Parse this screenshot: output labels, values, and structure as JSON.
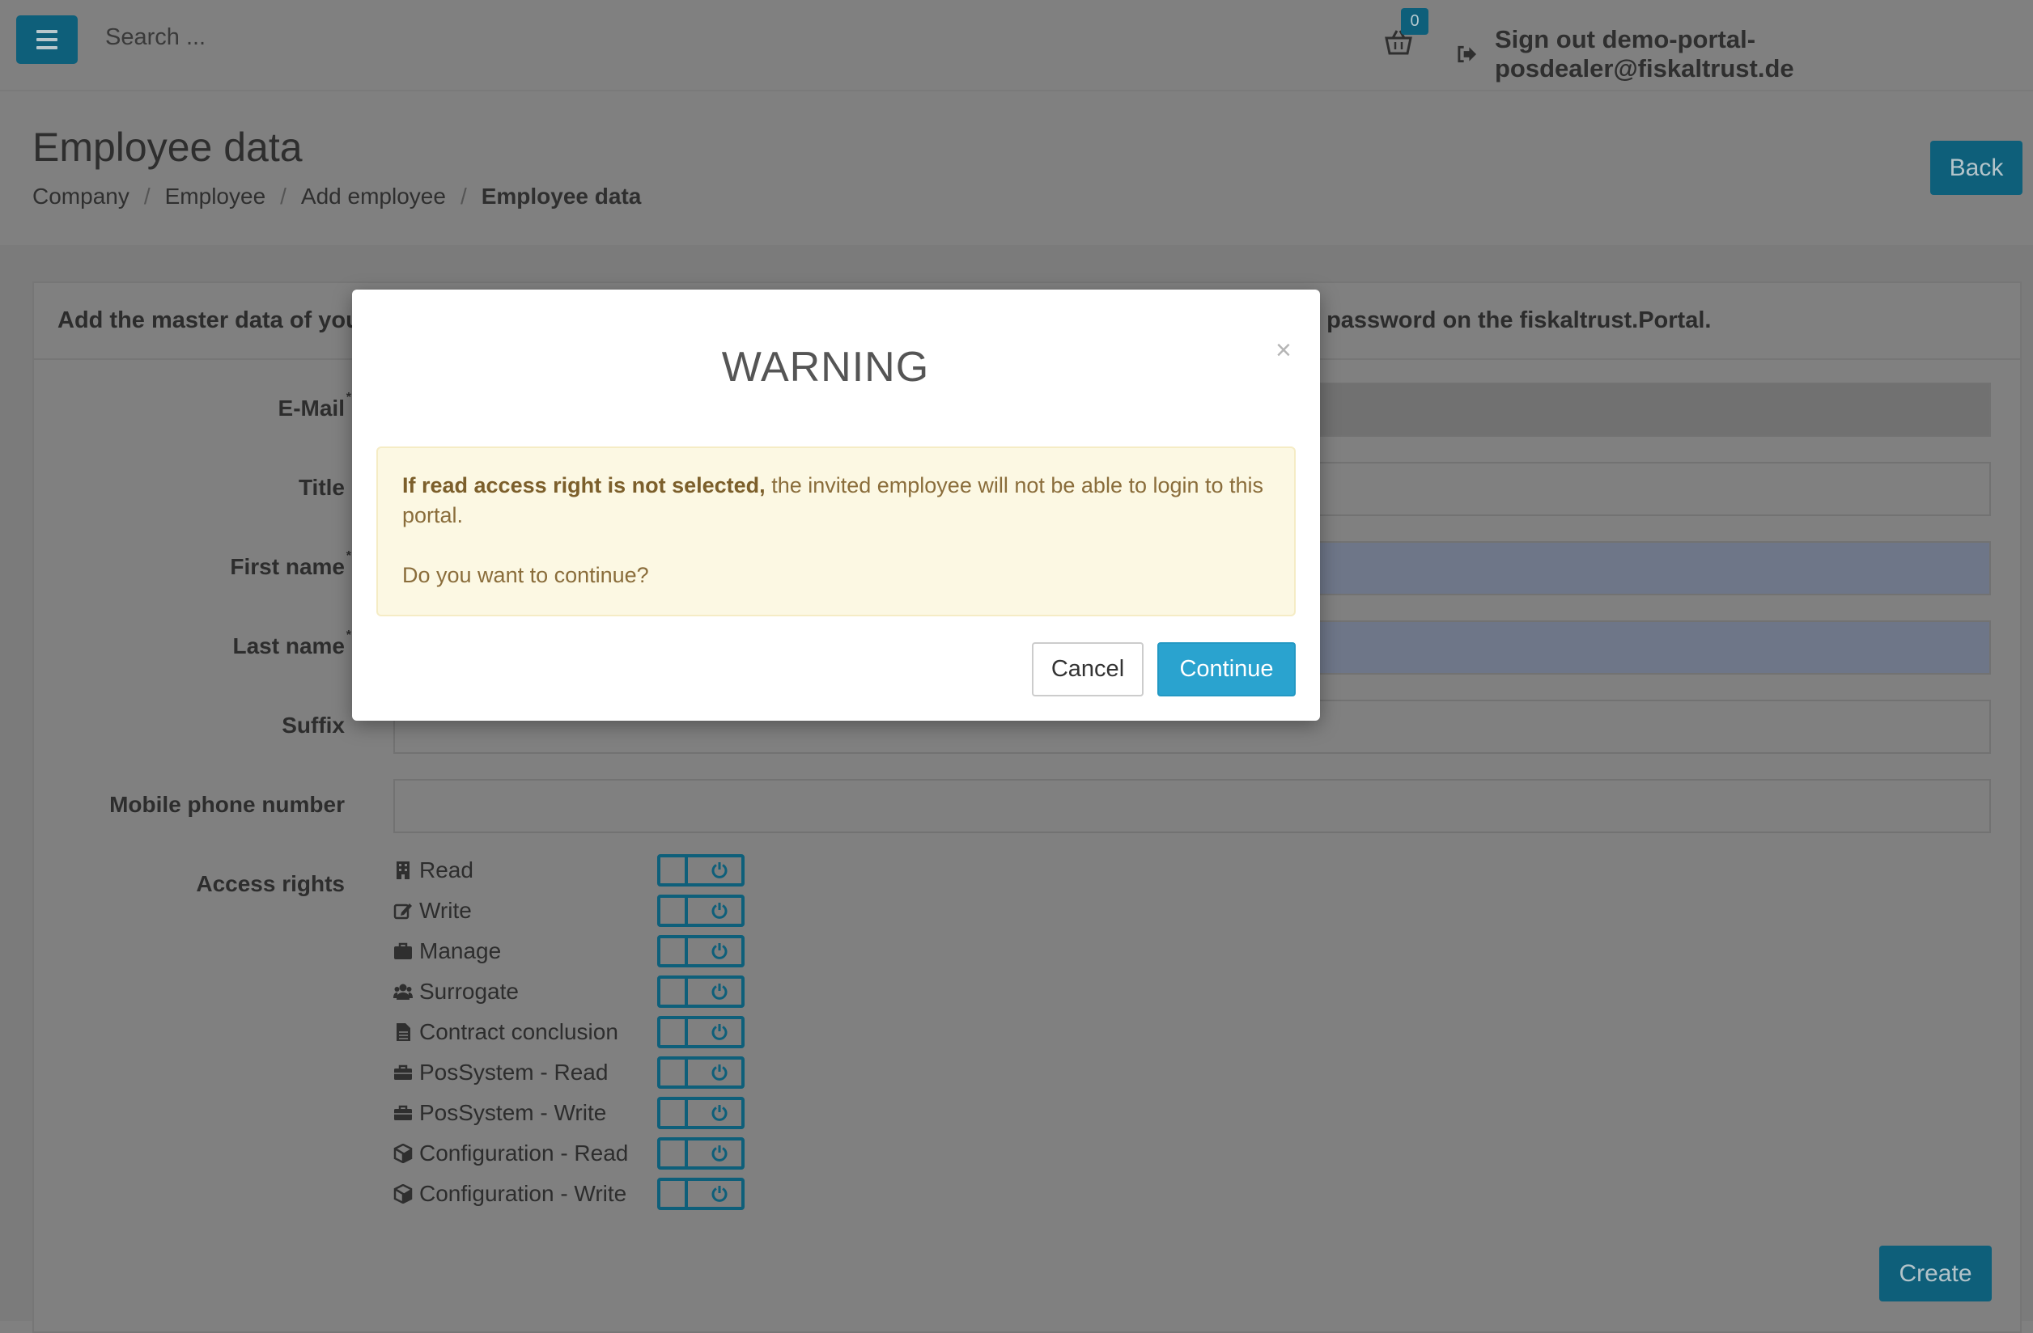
{
  "navbar": {
    "search_placeholder": "Search ...",
    "cart_count": "0",
    "signout_label": "Sign out demo-portal-posdealer@fiskaltrust.de"
  },
  "header": {
    "title": "Employee data",
    "breadcrumb": [
      "Company",
      "Employee",
      "Add employee",
      "Employee data"
    ],
    "back_label": "Back"
  },
  "panel": {
    "heading_left": "Add the master data of you",
    "heading_right": "al password on the fiskaltrust.Portal."
  },
  "form": {
    "labels": {
      "email": "E-Mail",
      "title": "Title",
      "first_name": "First name",
      "last_name": "Last name",
      "suffix": "Suffix",
      "mobile": "Mobile phone number",
      "access_rights": "Access rights"
    },
    "required_mark": "*"
  },
  "access_rights": [
    {
      "label": "Read",
      "icon": "building-icon"
    },
    {
      "label": "Write",
      "icon": "edit-icon"
    },
    {
      "label": "Manage",
      "icon": "briefcase-icon"
    },
    {
      "label": "Surrogate",
      "icon": "users-icon"
    },
    {
      "label": "Contract conclusion",
      "icon": "file-icon"
    },
    {
      "label": "PosSystem - Read",
      "icon": "toolbox-icon"
    },
    {
      "label": "PosSystem - Write",
      "icon": "toolbox-icon"
    },
    {
      "label": "Configuration - Read",
      "icon": "cube-icon"
    },
    {
      "label": "Configuration - Write",
      "icon": "cube-icon"
    }
  ],
  "create_label": "Create",
  "modal": {
    "title": "WARNING",
    "close": "×",
    "alert_bold": "If read access right is not selected,",
    "alert_text": " the invited employee will not be able to login to this portal.",
    "question": "Do you want to continue?",
    "cancel_label": "Cancel",
    "continue_label": "Continue"
  },
  "colors": {
    "primary_dark": "#0e5f7a",
    "info": "#2aa3cf",
    "warning_bg": "#fcf8e3",
    "warning_text": "#8a6d3b"
  }
}
